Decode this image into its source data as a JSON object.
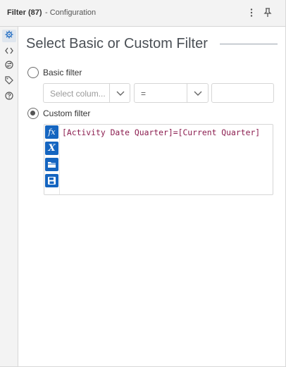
{
  "header": {
    "title": "Filter (87)",
    "subtitle": "- Configuration",
    "more_icon": "more-vertical-icon",
    "pin_icon": "pin-icon"
  },
  "sidebar": {
    "items": [
      {
        "icon": "gear-icon",
        "active": true
      },
      {
        "icon": "code-icon",
        "active": false
      },
      {
        "icon": "connection-icon",
        "active": false
      },
      {
        "icon": "tag-icon",
        "active": false
      },
      {
        "icon": "help-icon",
        "active": false
      }
    ]
  },
  "main": {
    "heading": "Select Basic or Custom Filter",
    "basic": {
      "label": "Basic filter",
      "selected": false,
      "column_placeholder": "Select colum...",
      "operator_value": "=",
      "value_text": ""
    },
    "custom": {
      "label": "Custom filter",
      "selected": true,
      "expression": "[Activity Date Quarter]=[Current Quarter]",
      "tools": [
        "function-icon",
        "variable-icon",
        "open-folder-icon",
        "save-icon"
      ]
    }
  },
  "colors": {
    "accent": "#1565c0",
    "expression_text": "#8b1d4f",
    "panel_bg": "#f3f3f3"
  }
}
